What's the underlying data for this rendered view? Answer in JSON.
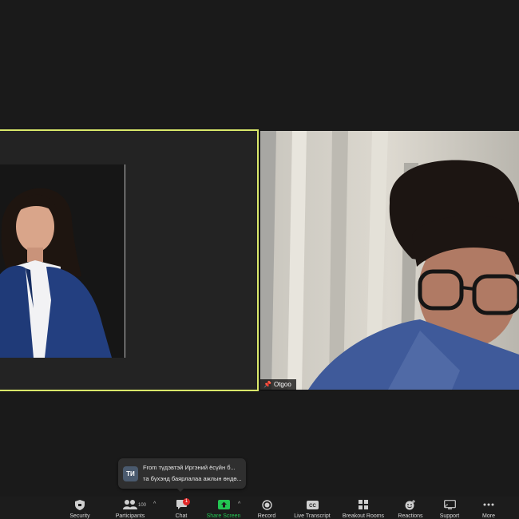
{
  "participants": {
    "right_name": "Otgoo"
  },
  "chat_toast": {
    "avatar_initials": "ТИ",
    "line1": "From түдэвтэй Иргэний ёсүйн б...",
    "line2": "та бүхэнд баярлалаа ажлын өндө..."
  },
  "toolbar": {
    "security_label": "Security",
    "participants_label": "Participants",
    "participants_count": "100",
    "chat_label": "Chat",
    "chat_badge": "1",
    "share_label": "Share Screen",
    "record_label": "Record",
    "transcript_label": "Live Transcript",
    "breakout_label": "Breakout Rooms",
    "reactions_label": "Reactions",
    "support_label": "Support",
    "more_label": "More"
  },
  "colors": {
    "active_speaker_border": "#d9e86a",
    "share_green": "#23c552",
    "badge_red": "#e02828"
  }
}
